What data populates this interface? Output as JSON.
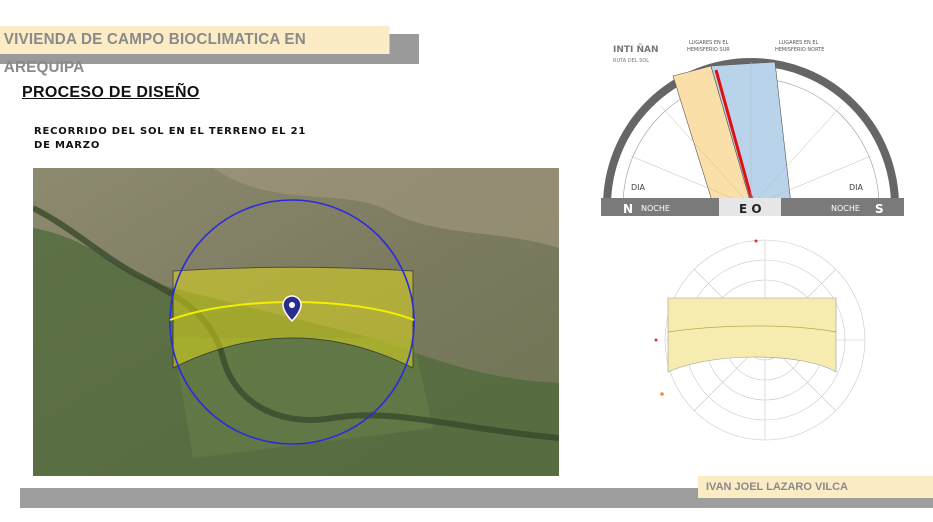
{
  "header": {
    "title": "VIVIENDA DE CAMPO BIOCLIMATICA EN AREQUIPA"
  },
  "section": {
    "title": "PROCESO DE DISEÑO"
  },
  "caption": {
    "line1": "RECORRIDO DEL SOL EN EL TERRENO EL 21",
    "line2": "DE MARZO"
  },
  "sunpath_chart": {
    "brand": "INTI ÑAN",
    "subtitle": "RUTA DEL SOL",
    "left_header_1": "LUGARES EN EL",
    "left_header_2": "HEMISFERIO SUR",
    "right_header_1": "LUGARES EN EL",
    "right_header_2": "HEMISFERIO NORTE",
    "day_left": "DIA",
    "day_right": "DIA",
    "night_left": "NOCHE",
    "night_right": "NOCHE",
    "north": "N",
    "south": "S",
    "east_west": "E O"
  },
  "footer": {
    "author": "IVAN JOEL LAZARO VILCA"
  },
  "colors": {
    "title_band": "#fcecc6",
    "grey_band": "#9e9e9e",
    "sun_band": "#f3e79a",
    "sun_path": "#e8e800"
  }
}
